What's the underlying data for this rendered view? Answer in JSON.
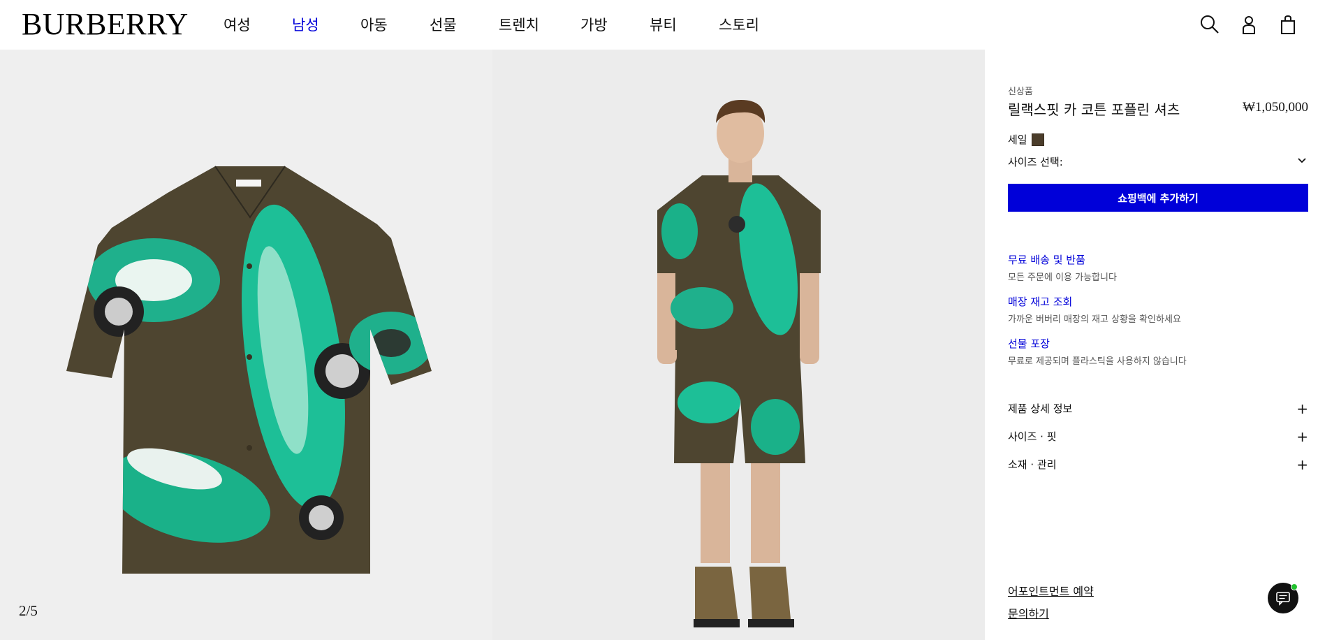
{
  "header": {
    "logo": "BURBERRY",
    "nav": [
      {
        "label": "여성",
        "active": false
      },
      {
        "label": "남성",
        "active": true
      },
      {
        "label": "아동",
        "active": false
      },
      {
        "label": "선물",
        "active": false
      },
      {
        "label": "트렌치",
        "active": false
      },
      {
        "label": "가방",
        "active": false
      },
      {
        "label": "뷰티",
        "active": false
      },
      {
        "label": "스토리",
        "active": false
      }
    ],
    "icons": [
      "search-icon",
      "account-icon",
      "shopping-bag-icon"
    ]
  },
  "gallery": {
    "counter": "2/5"
  },
  "product": {
    "tag": "신상품",
    "title": "릴랙스핏 카 코튼 포플린 셔츠",
    "price": "₩1,050,000",
    "color_label": "세일",
    "color_hex": "#4b3d2b",
    "size_label": "사이즈 선택:",
    "add_to_bag": "쇼핑백에 추가하기"
  },
  "services": [
    {
      "title": "무료 배송 및 반품",
      "desc": "모든 주문에 이용 가능합니다"
    },
    {
      "title": "매장 재고 조회",
      "desc": "가까운 버버리 매장의 재고 상황을 확인하세요"
    },
    {
      "title": "선물 포장",
      "desc": "무료로 제공되며 플라스틱을 사용하지 않습니다"
    }
  ],
  "accordion": [
    {
      "label": "제품 상세 정보"
    },
    {
      "label": "사이즈 · 핏"
    },
    {
      "label": "소재 · 관리"
    }
  ],
  "footer_links": {
    "appointment": "어포인트먼트 예약",
    "contact": "문의하기"
  },
  "colors": {
    "accent": "#0000d9",
    "chat_online": "#22c22e"
  }
}
